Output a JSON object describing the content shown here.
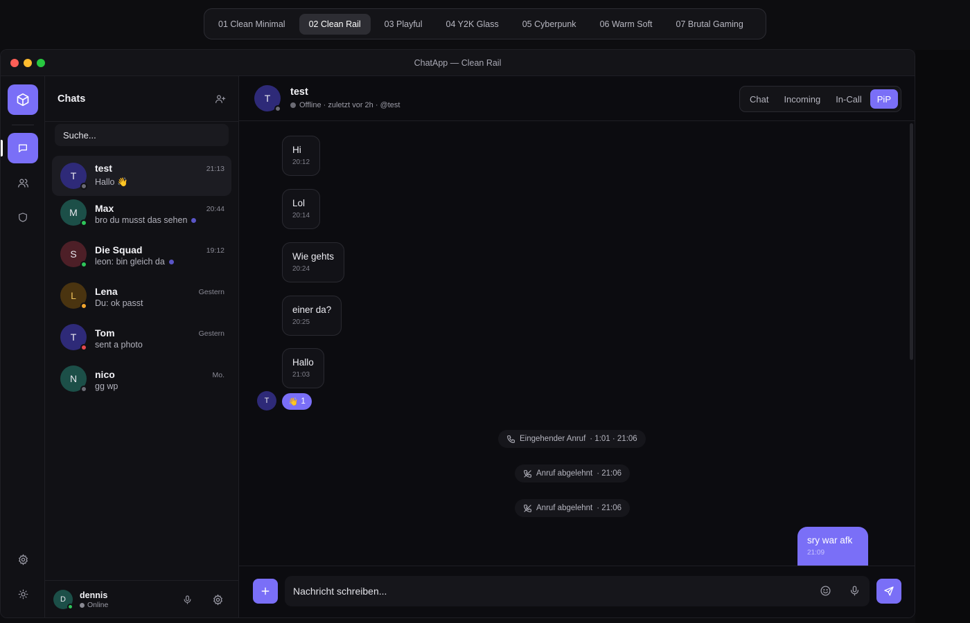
{
  "themes": [
    {
      "label": "01 Clean Minimal",
      "active": false
    },
    {
      "label": "02 Clean Rail",
      "active": true
    },
    {
      "label": "03 Playful",
      "active": false
    },
    {
      "label": "04 Y2K Glass",
      "active": false
    },
    {
      "label": "05 Cyberpunk",
      "active": false
    },
    {
      "label": "06 Warm Soft",
      "active": false
    },
    {
      "label": "07 Brutal Gaming",
      "active": false
    }
  ],
  "window": {
    "title": "ChatApp — Clean Rail"
  },
  "rail": {
    "items": [
      "chat-icon",
      "users-icon",
      "shield-icon"
    ],
    "bottom": [
      "gear-icon",
      "sun-icon"
    ],
    "accent": "#7a6ff7"
  },
  "chatlist": {
    "title": "Chats",
    "search_placeholder": "Suche...",
    "items": [
      {
        "initial": "T",
        "name": "test",
        "time": "21:13",
        "preview": "Hallo 👋",
        "unread": false,
        "status": "offline"
      },
      {
        "initial": "M",
        "name": "Max",
        "time": "20:44",
        "preview": "bro du musst das sehen",
        "unread": true,
        "status": "online"
      },
      {
        "initial": "S",
        "name": "Die Squad",
        "time": "19:12",
        "preview": "leon: bin gleich da",
        "unread": true,
        "status": "online"
      },
      {
        "initial": "L",
        "name": "Lena",
        "time": "Gestern",
        "preview": "Du: ok passt",
        "unread": false,
        "status": "away"
      },
      {
        "initial": "T",
        "name": "Tom",
        "time": "Gestern",
        "preview": "sent a photo",
        "unread": false,
        "status": "busy"
      },
      {
        "initial": "N",
        "name": "nico",
        "time": "Mo.",
        "preview": "gg wp",
        "unread": false,
        "status": "offline"
      }
    ]
  },
  "user": {
    "initial": "D",
    "name": "dennis",
    "status": "Online"
  },
  "conversation": {
    "contact": {
      "initial": "T",
      "name": "test",
      "status_line": "Offline · zuletzt vor 2h · @test"
    },
    "tabs": [
      {
        "label": "Chat",
        "active": false
      },
      {
        "label": "Incoming",
        "active": false
      },
      {
        "label": "In-Call",
        "active": false
      },
      {
        "label": "PiP",
        "active": true
      }
    ],
    "messages": [
      {
        "text": "Hi",
        "time": "20:12"
      },
      {
        "text": "Lol",
        "time": "20:14"
      },
      {
        "text": "Wie gehts",
        "time": "20:24"
      },
      {
        "text": "einer da?",
        "time": "20:25"
      },
      {
        "text": "Hallo",
        "time": "21:03"
      }
    ],
    "reaction": {
      "avatar": "T",
      "emoji": "👋",
      "count": "1"
    },
    "system": [
      {
        "icon": "phone-icon",
        "label": "Eingehender Anruf",
        "detail": "· 1:01 · 21:06"
      },
      {
        "icon": "phone-off-icon",
        "label": "Anruf abgelehnt",
        "detail": "· 21:06"
      },
      {
        "icon": "phone-off-icon",
        "label": "Anruf abgelehnt",
        "detail": "· 21:06"
      }
    ],
    "outgoing": {
      "text": "sry war afk",
      "time": "21:09"
    },
    "composer_placeholder": "Nachricht schreiben..."
  }
}
